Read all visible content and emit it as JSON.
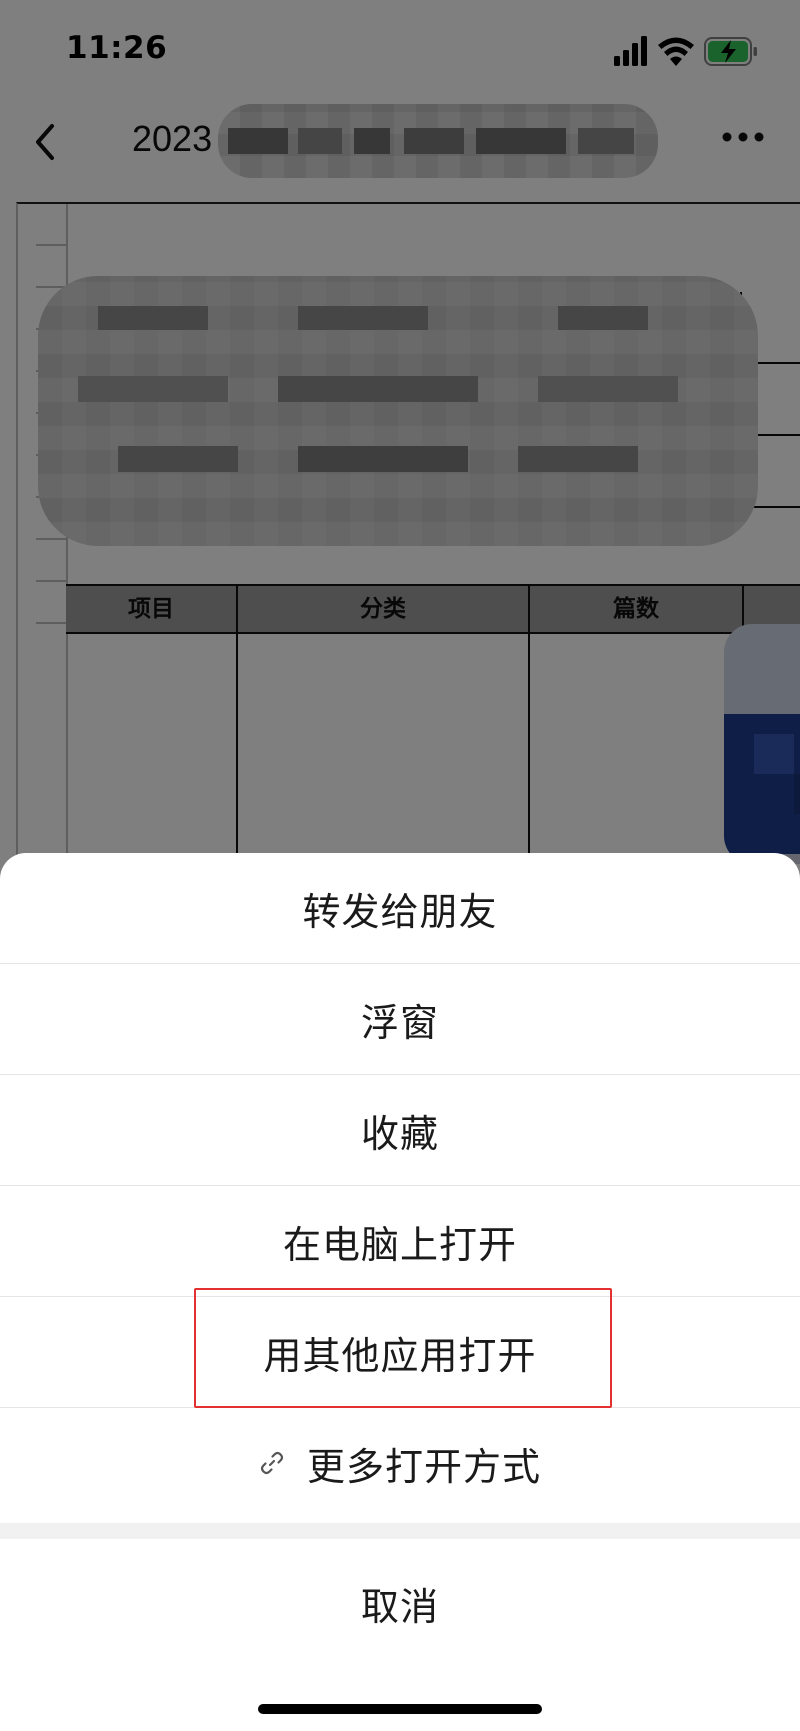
{
  "status_bar": {
    "time": "11:26"
  },
  "nav": {
    "title_visible": "2023"
  },
  "document": {
    "table_headers": [
      "项目",
      "分类",
      "篇数"
    ]
  },
  "action_sheet": {
    "items": [
      {
        "label": "转发给朋友"
      },
      {
        "label": "浮窗"
      },
      {
        "label": "收藏"
      },
      {
        "label": "在电脑上打开"
      },
      {
        "label": "用其他应用打开"
      },
      {
        "label": "更多打开方式"
      }
    ],
    "cancel_label": "取消"
  },
  "colors": {
    "highlight_border": "#e33030",
    "battery_green": "#35c759"
  }
}
